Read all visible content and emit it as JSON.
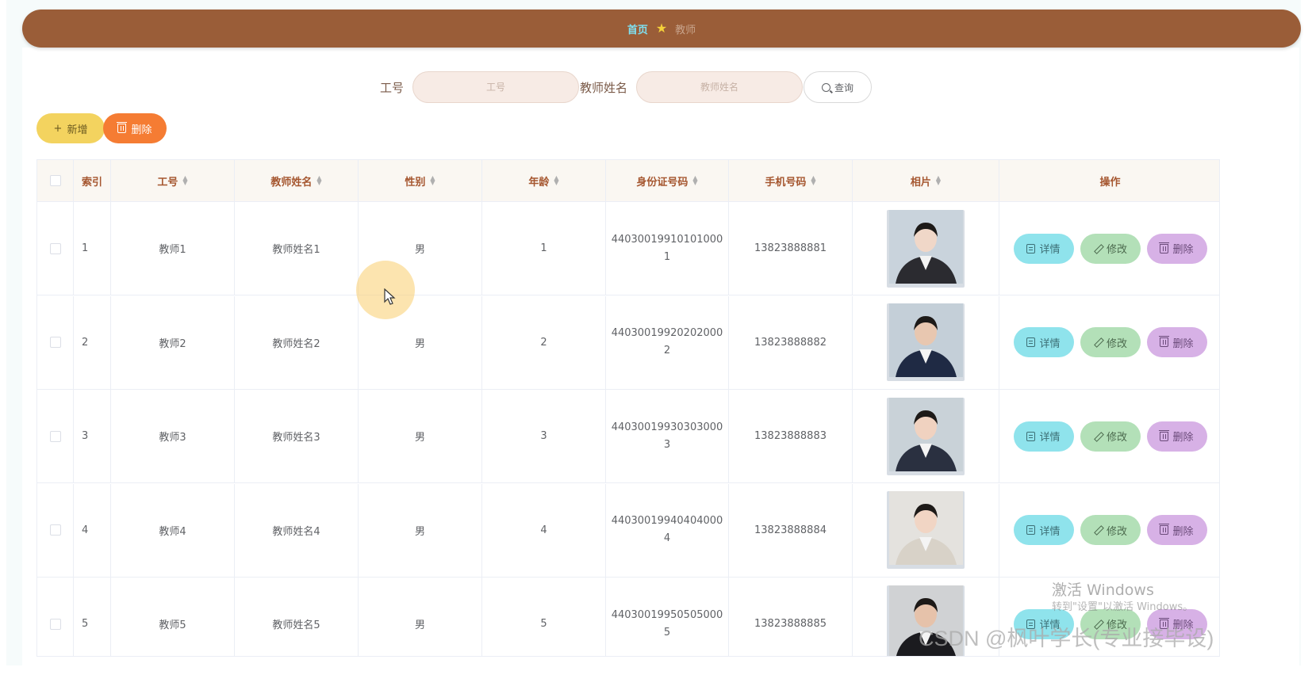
{
  "breadcrumb": {
    "home": "首页",
    "separator_icon": "star-icon",
    "current": "教师"
  },
  "search": {
    "field1_label": "工号",
    "field1_placeholder": "工号",
    "field2_label": "教师姓名",
    "field2_placeholder": "教师姓名",
    "query_button": "查询"
  },
  "toolbar": {
    "add_label": "新增",
    "delete_label": "删除"
  },
  "table": {
    "headers": {
      "index": "索引",
      "job_no": "工号",
      "teacher_name": "教师姓名",
      "gender": "性别",
      "age": "年龄",
      "id_number": "身份证号码",
      "phone": "手机号码",
      "photo": "相片",
      "actions": "操作"
    },
    "action_labels": {
      "detail": "详情",
      "edit": "修改",
      "delete": "删除"
    },
    "rows": [
      {
        "index": "1",
        "job_no": "教师1",
        "teacher_name": "教师姓名1",
        "gender": "男",
        "age": "1",
        "id_line1": "44030019910101000",
        "id_line2": "1",
        "phone": "13823888881"
      },
      {
        "index": "2",
        "job_no": "教师2",
        "teacher_name": "教师姓名2",
        "gender": "男",
        "age": "2",
        "id_line1": "44030019920202000",
        "id_line2": "2",
        "phone": "13823888882"
      },
      {
        "index": "3",
        "job_no": "教师3",
        "teacher_name": "教师姓名3",
        "gender": "男",
        "age": "3",
        "id_line1": "44030019930303000",
        "id_line2": "3",
        "phone": "13823888883"
      },
      {
        "index": "4",
        "job_no": "教师4",
        "teacher_name": "教师姓名4",
        "gender": "男",
        "age": "4",
        "id_line1": "44030019940404000",
        "id_line2": "4",
        "phone": "13823888884"
      },
      {
        "index": "5",
        "job_no": "教师5",
        "teacher_name": "教师姓名5",
        "gender": "男",
        "age": "5",
        "id_line1": "44030019950505000",
        "id_line2": "5",
        "phone": "13823888885"
      }
    ]
  },
  "watermarks": {
    "windows_title": "激活 Windows",
    "windows_sub": "转到\"设置\"以激活 Windows。",
    "csdn": "CSDN @枫叶学长(专业接毕设)"
  },
  "colors": {
    "topbar": "#9a5d38",
    "add_button": "#f3d35f",
    "delete_button": "#f57c33",
    "detail_button": "#8fe3ec",
    "edit_button": "#b3e0b8",
    "remove_button": "#d7b1e6"
  }
}
